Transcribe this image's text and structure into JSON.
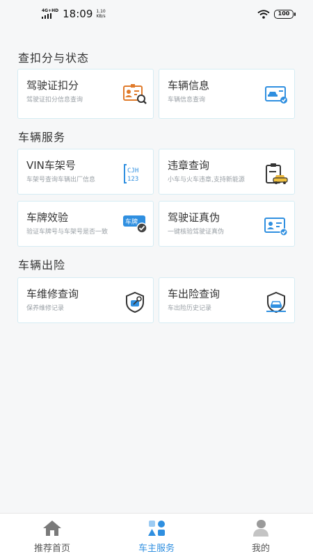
{
  "status_bar": {
    "network": "4G+HD",
    "time": "18:09",
    "speed_value": "1.10",
    "speed_unit": "KB/s",
    "battery": "100"
  },
  "sections": {
    "points": {
      "title": "查扣分与状态"
    },
    "vehicle": {
      "title": "车辆服务"
    },
    "insurance": {
      "title": "车辆出险"
    }
  },
  "cards": {
    "license_points": {
      "title": "驾驶证扣分",
      "desc": "驾驶证扣分信息查询",
      "icon": "id-card-search-icon"
    },
    "vehicle_info": {
      "title": "车辆信息",
      "desc": "车辆信息查询",
      "icon": "vehicle-card-icon"
    },
    "vin": {
      "title": "VIN车架号",
      "desc": "车架号查询车辆出厂信息",
      "icon": "vin-code-icon",
      "icon_text_1": "CJH",
      "icon_text_2": "123"
    },
    "violation": {
      "title": "违章查询",
      "desc": "小车与火车违章,支持新能源",
      "icon": "clipboard-car-icon"
    },
    "plate_check": {
      "title": "车牌效验",
      "desc": "验证车牌号与车架号是否一致",
      "icon": "plate-check-icon",
      "icon_text": "车牌"
    },
    "license_auth": {
      "title": "驾驶证真伪",
      "desc": "一键核验驾驶证真伪",
      "icon": "license-verify-icon"
    },
    "repair": {
      "title": "车维修查询",
      "desc": "保养维修记录",
      "icon": "shield-repair-icon"
    },
    "claims": {
      "title": "车出险查询",
      "desc": "车出险历史记录",
      "icon": "shield-car-icon"
    }
  },
  "bottom_nav": [
    {
      "label": "推荐首页",
      "icon": "home-icon",
      "active": false
    },
    {
      "label": "车主服务",
      "icon": "services-icon",
      "active": true
    },
    {
      "label": "我的",
      "icon": "user-icon",
      "active": false
    }
  ],
  "colors": {
    "accent": "#2f8fe0",
    "orange": "#e07a2a",
    "border": "#d5ecf3"
  }
}
